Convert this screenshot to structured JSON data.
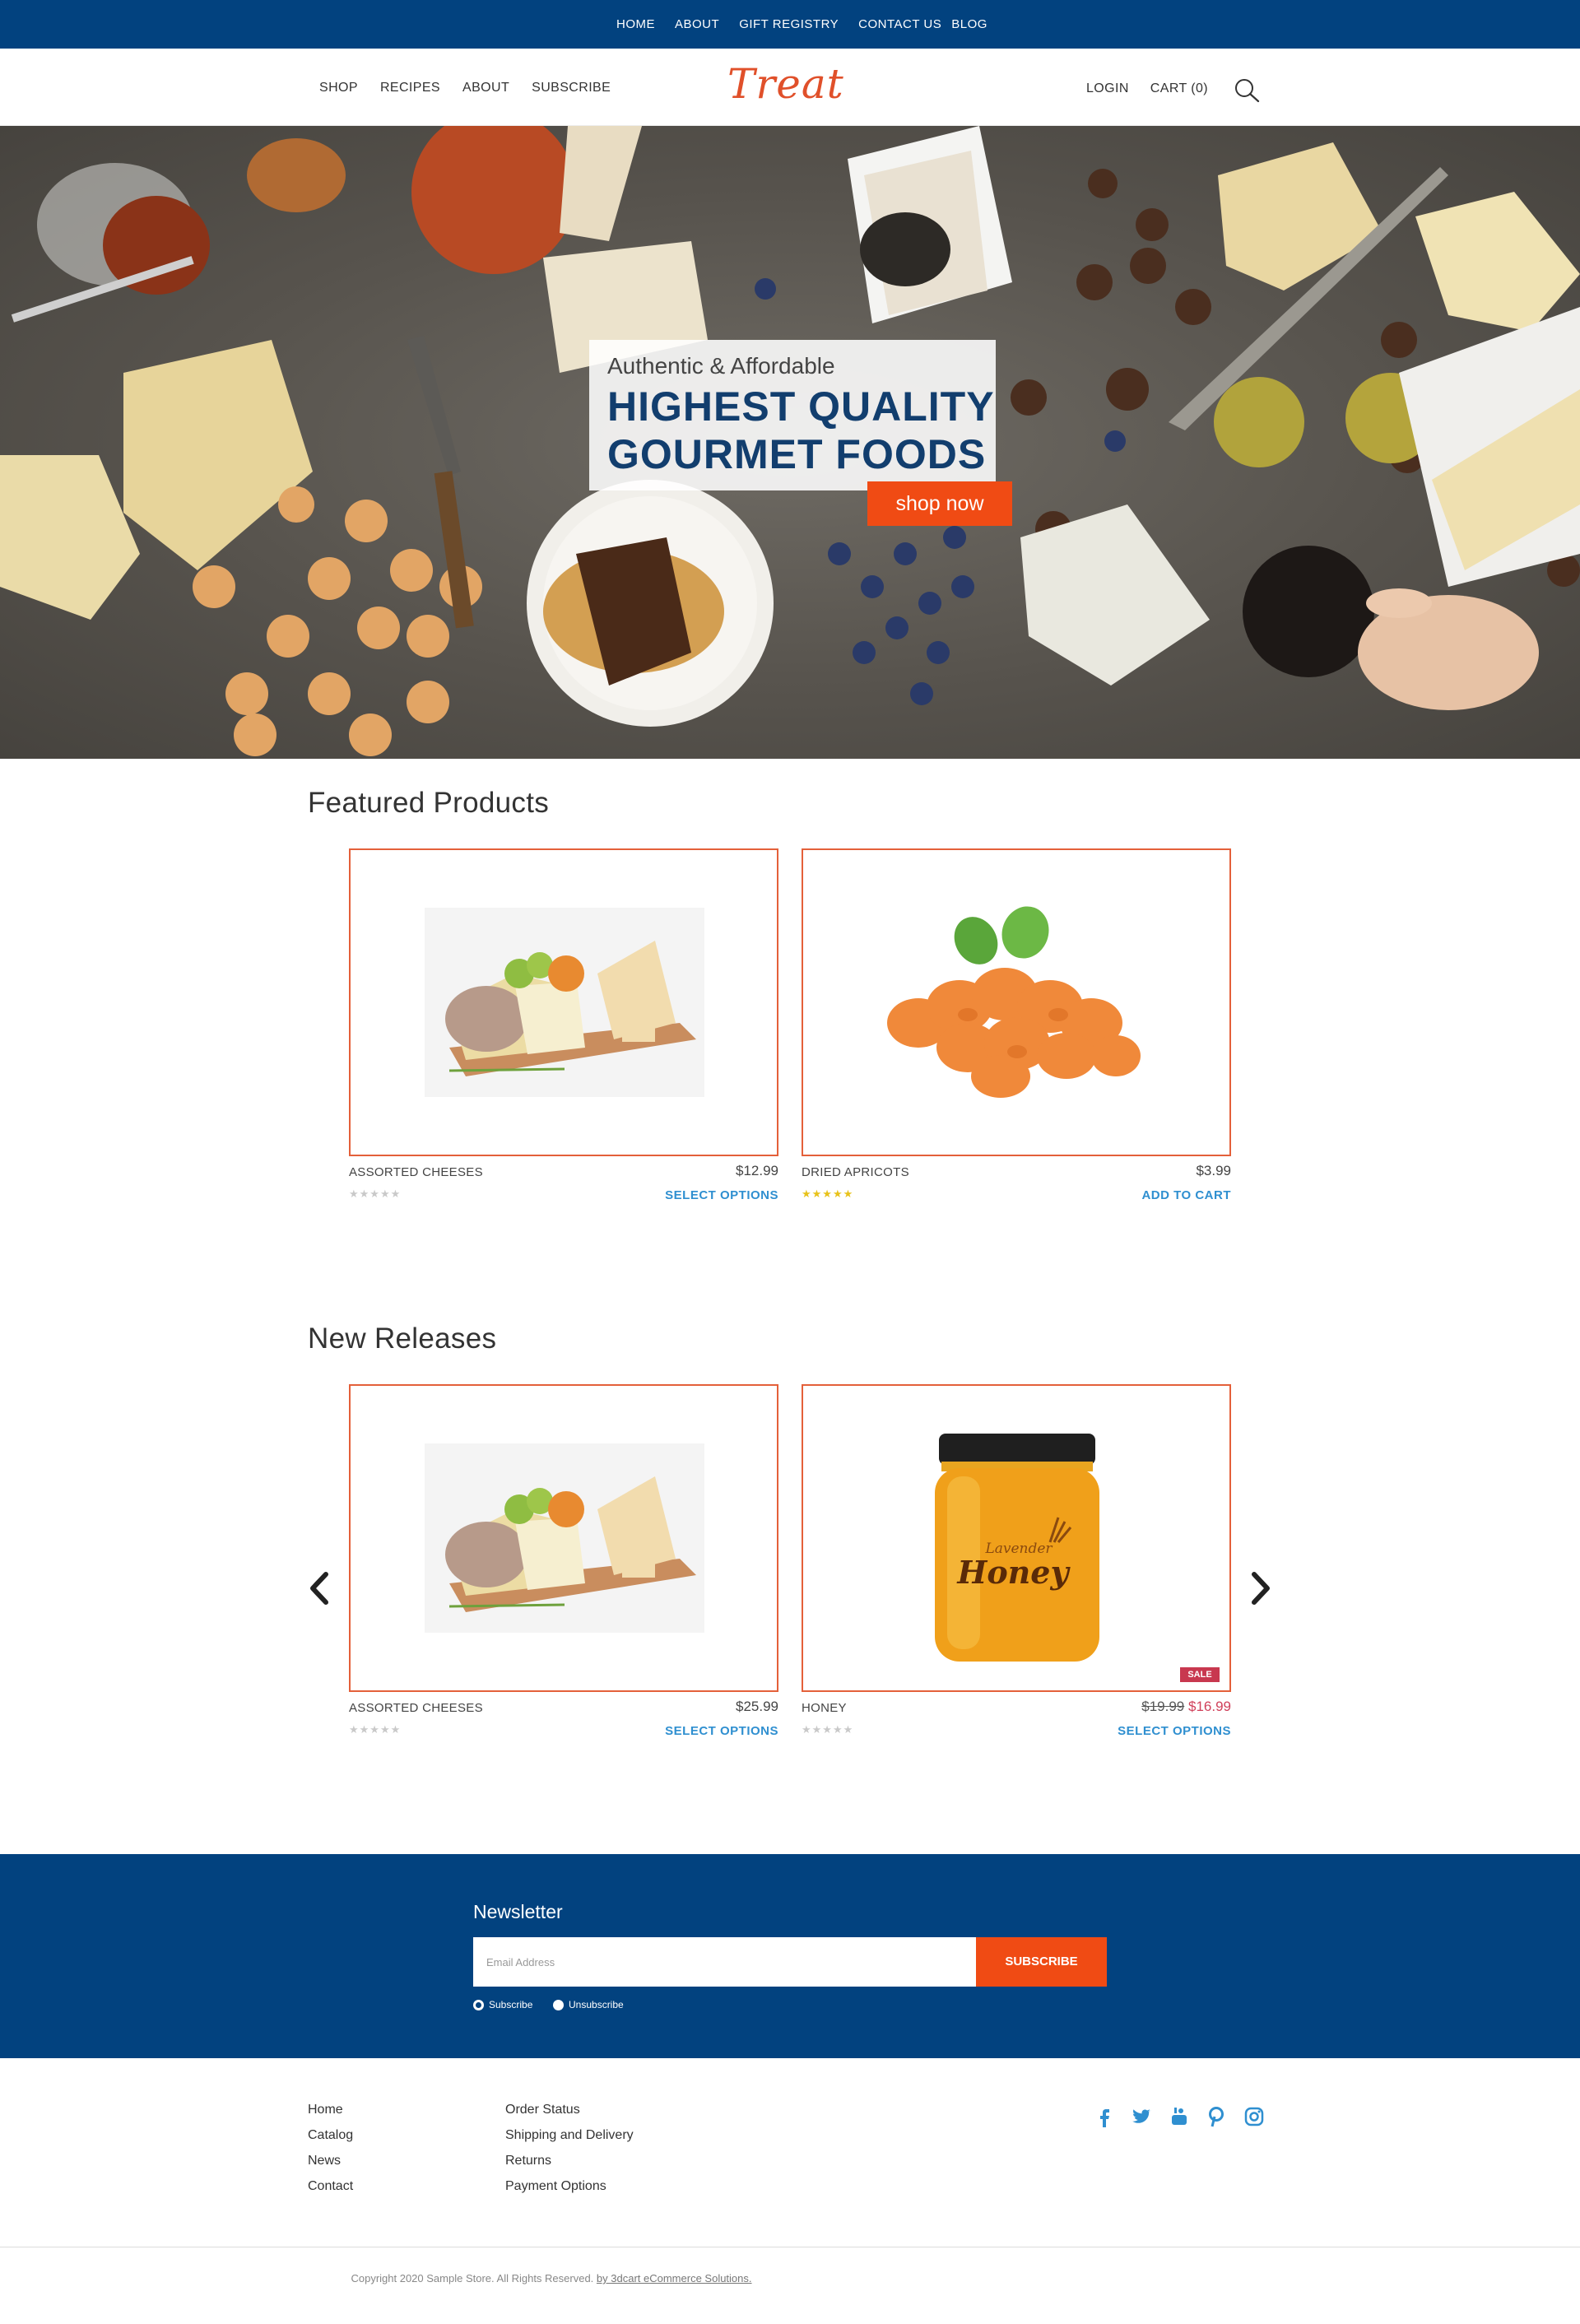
{
  "colors": {
    "brand_blue": "#02427f",
    "accent_orange": "#f04b14",
    "card_border": "#e4603a",
    "link_blue": "#2f8fd0",
    "sale_red": "#c8384f"
  },
  "topbar": {
    "links": [
      "HOME",
      "ABOUT",
      "GIFT REGISTRY",
      "CONTACT US",
      "BLOG"
    ]
  },
  "header": {
    "nav": [
      "SHOP",
      "RECIPES",
      "ABOUT",
      "SUBSCRIBE"
    ],
    "logo_text": "Treat",
    "login": "LOGIN",
    "cart": "CART (0)",
    "search_icon": "search-icon"
  },
  "hero": {
    "subtitle": "Authentic & Affordable",
    "title_line1": "HIGHEST QUALITY",
    "title_line2": "GOURMET FOODS",
    "cta": "shop now"
  },
  "featured": {
    "title": "Featured Products",
    "products": [
      {
        "name": "ASSORTED CHEESES",
        "price": "$12.99",
        "action": "SELECT OPTIONS",
        "rating": 0,
        "image": "cheese-board"
      },
      {
        "name": "DRIED APRICOTS",
        "price": "$3.99",
        "action": "ADD TO CART",
        "rating": 5,
        "image": "dried-apricots"
      }
    ]
  },
  "new_releases": {
    "title": "New Releases",
    "products": [
      {
        "name": "ASSORTED CHEESES",
        "price": "$25.99",
        "action": "SELECT OPTIONS",
        "rating": 0,
        "image": "cheese-board"
      },
      {
        "name": "HONEY",
        "price_old": "$19.99",
        "price_new": "$16.99",
        "action": "SELECT OPTIONS",
        "rating": 0,
        "sale_badge": "SALE",
        "image": "honey-jar",
        "jar_label_top": "Lavender",
        "jar_label_main": "Honey"
      }
    ],
    "prev_icon": "chevron-left-icon",
    "next_icon": "chevron-right-icon"
  },
  "newsletter": {
    "title": "Newsletter",
    "placeholder": "Email Address",
    "button": "SUBSCRIBE",
    "options": [
      {
        "label": "Subscribe",
        "selected": true
      },
      {
        "label": "Unsubscribe",
        "selected": false
      }
    ]
  },
  "footer": {
    "col1": [
      "Home",
      "Catalog",
      "News",
      "Contact"
    ],
    "col2": [
      "Order Status",
      "Shipping and Delivery",
      "Returns",
      "Payment Options"
    ],
    "social": [
      "facebook-icon",
      "twitter-icon",
      "youtube-icon",
      "pinterest-icon",
      "instagram-icon"
    ],
    "copyright_text": "Copyright 2020 Sample Store. All Rights Reserved.",
    "copyright_link": "by 3dcart eCommerce Solutions."
  }
}
